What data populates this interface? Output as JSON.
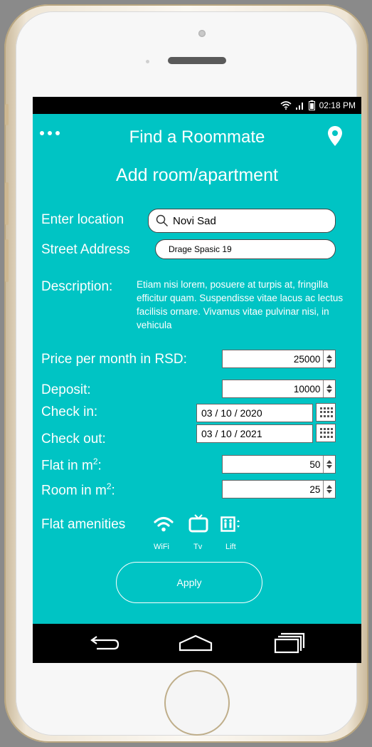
{
  "status": {
    "time": "02:18 PM",
    "icons": [
      "wifi-icon",
      "signal-icon",
      "battery-icon"
    ]
  },
  "appbar": {
    "title": "Find a Roommate",
    "menu_icon": "more-dots-icon",
    "location_icon": "map-pin-icon"
  },
  "page": {
    "title": "Add room/apartment"
  },
  "form": {
    "location": {
      "label": "Enter location",
      "value": "Novi Sad",
      "icon": "search-icon"
    },
    "street": {
      "label": "Street Address",
      "value": "Drage Spasic 19"
    },
    "description": {
      "label": "Description:",
      "text": "Etiam nisi lorem, posuere at turpis at, fringilla efficitur quam. Suspendisse vitae lacus ac lectus facilisis ornare. Vivamus vitae pulvinar nisi, in vehicula"
    },
    "price": {
      "label": "Price per month in RSD:",
      "value": "25000"
    },
    "deposit": {
      "label": "Deposit:",
      "value": "10000"
    },
    "checkin": {
      "label": "Check in:",
      "value": "03 / 10 / 2020"
    },
    "checkout": {
      "label": "Check out:",
      "value": "03 / 10 / 2021"
    },
    "flat": {
      "label": "Flat in m",
      "sup": "2",
      "suffix": ":",
      "value": "50"
    },
    "room": {
      "label": "Room in m",
      "sup": "2",
      "suffix": ":",
      "value": "25"
    }
  },
  "amenities": {
    "label": "Flat amenities",
    "items": [
      {
        "label": "WiFi",
        "icon": "wifi-icon"
      },
      {
        "label": "Tv",
        "icon": "tv-icon"
      },
      {
        "label": "Lift",
        "icon": "elevator-icon"
      }
    ]
  },
  "apply": {
    "label": "Apply"
  },
  "navbar": {
    "icons": [
      "back-icon",
      "home-icon",
      "recent-apps-icon"
    ]
  },
  "colors": {
    "screen": "#00c4c4",
    "bars": "#000000",
    "text": "#ffffff"
  }
}
